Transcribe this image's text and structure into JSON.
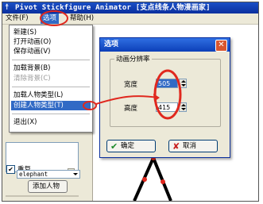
{
  "window": {
    "title": "Pivot Stickfigure Animator [支点线条人物漫画家]"
  },
  "menubar": {
    "items": [
      "文件(F)",
      "选项",
      "帮助(H)"
    ]
  },
  "file_menu": {
    "items": [
      {
        "label": "新建(S)",
        "state": "normal"
      },
      {
        "label": "打开动画(O)",
        "state": "normal"
      },
      {
        "label": "保存动画(V)",
        "state": "normal"
      },
      {
        "label": "加载背景(B)",
        "state": "normal"
      },
      {
        "label": "清除背景(C)",
        "state": "disabled"
      },
      {
        "label": "加载人物类型(L)",
        "state": "normal"
      },
      {
        "label": "创建人物类型(T)",
        "state": "selected"
      },
      {
        "label": "退出(X)",
        "state": "normal"
      }
    ]
  },
  "options_dialog": {
    "title": "选项",
    "close_glyph": "✕",
    "group_label": "动画分辨率",
    "width_label": "宽度",
    "width_value": "505",
    "height_label": "高度",
    "height_value": "415",
    "ok_label": "确定",
    "ok_icon": "check-icon",
    "cancel_label": "取消",
    "cancel_icon": "x-icon"
  },
  "left_panel": {
    "repeat_label": "重复",
    "repeat_checked": true,
    "figure_type_value": "elephant",
    "add_figure_label": "添加人物"
  },
  "colors": {
    "titlebar": "#0a2f9e",
    "selection": "#316ac5",
    "annotation_red": "#e0281e",
    "stick_joint": "#e0281e"
  }
}
